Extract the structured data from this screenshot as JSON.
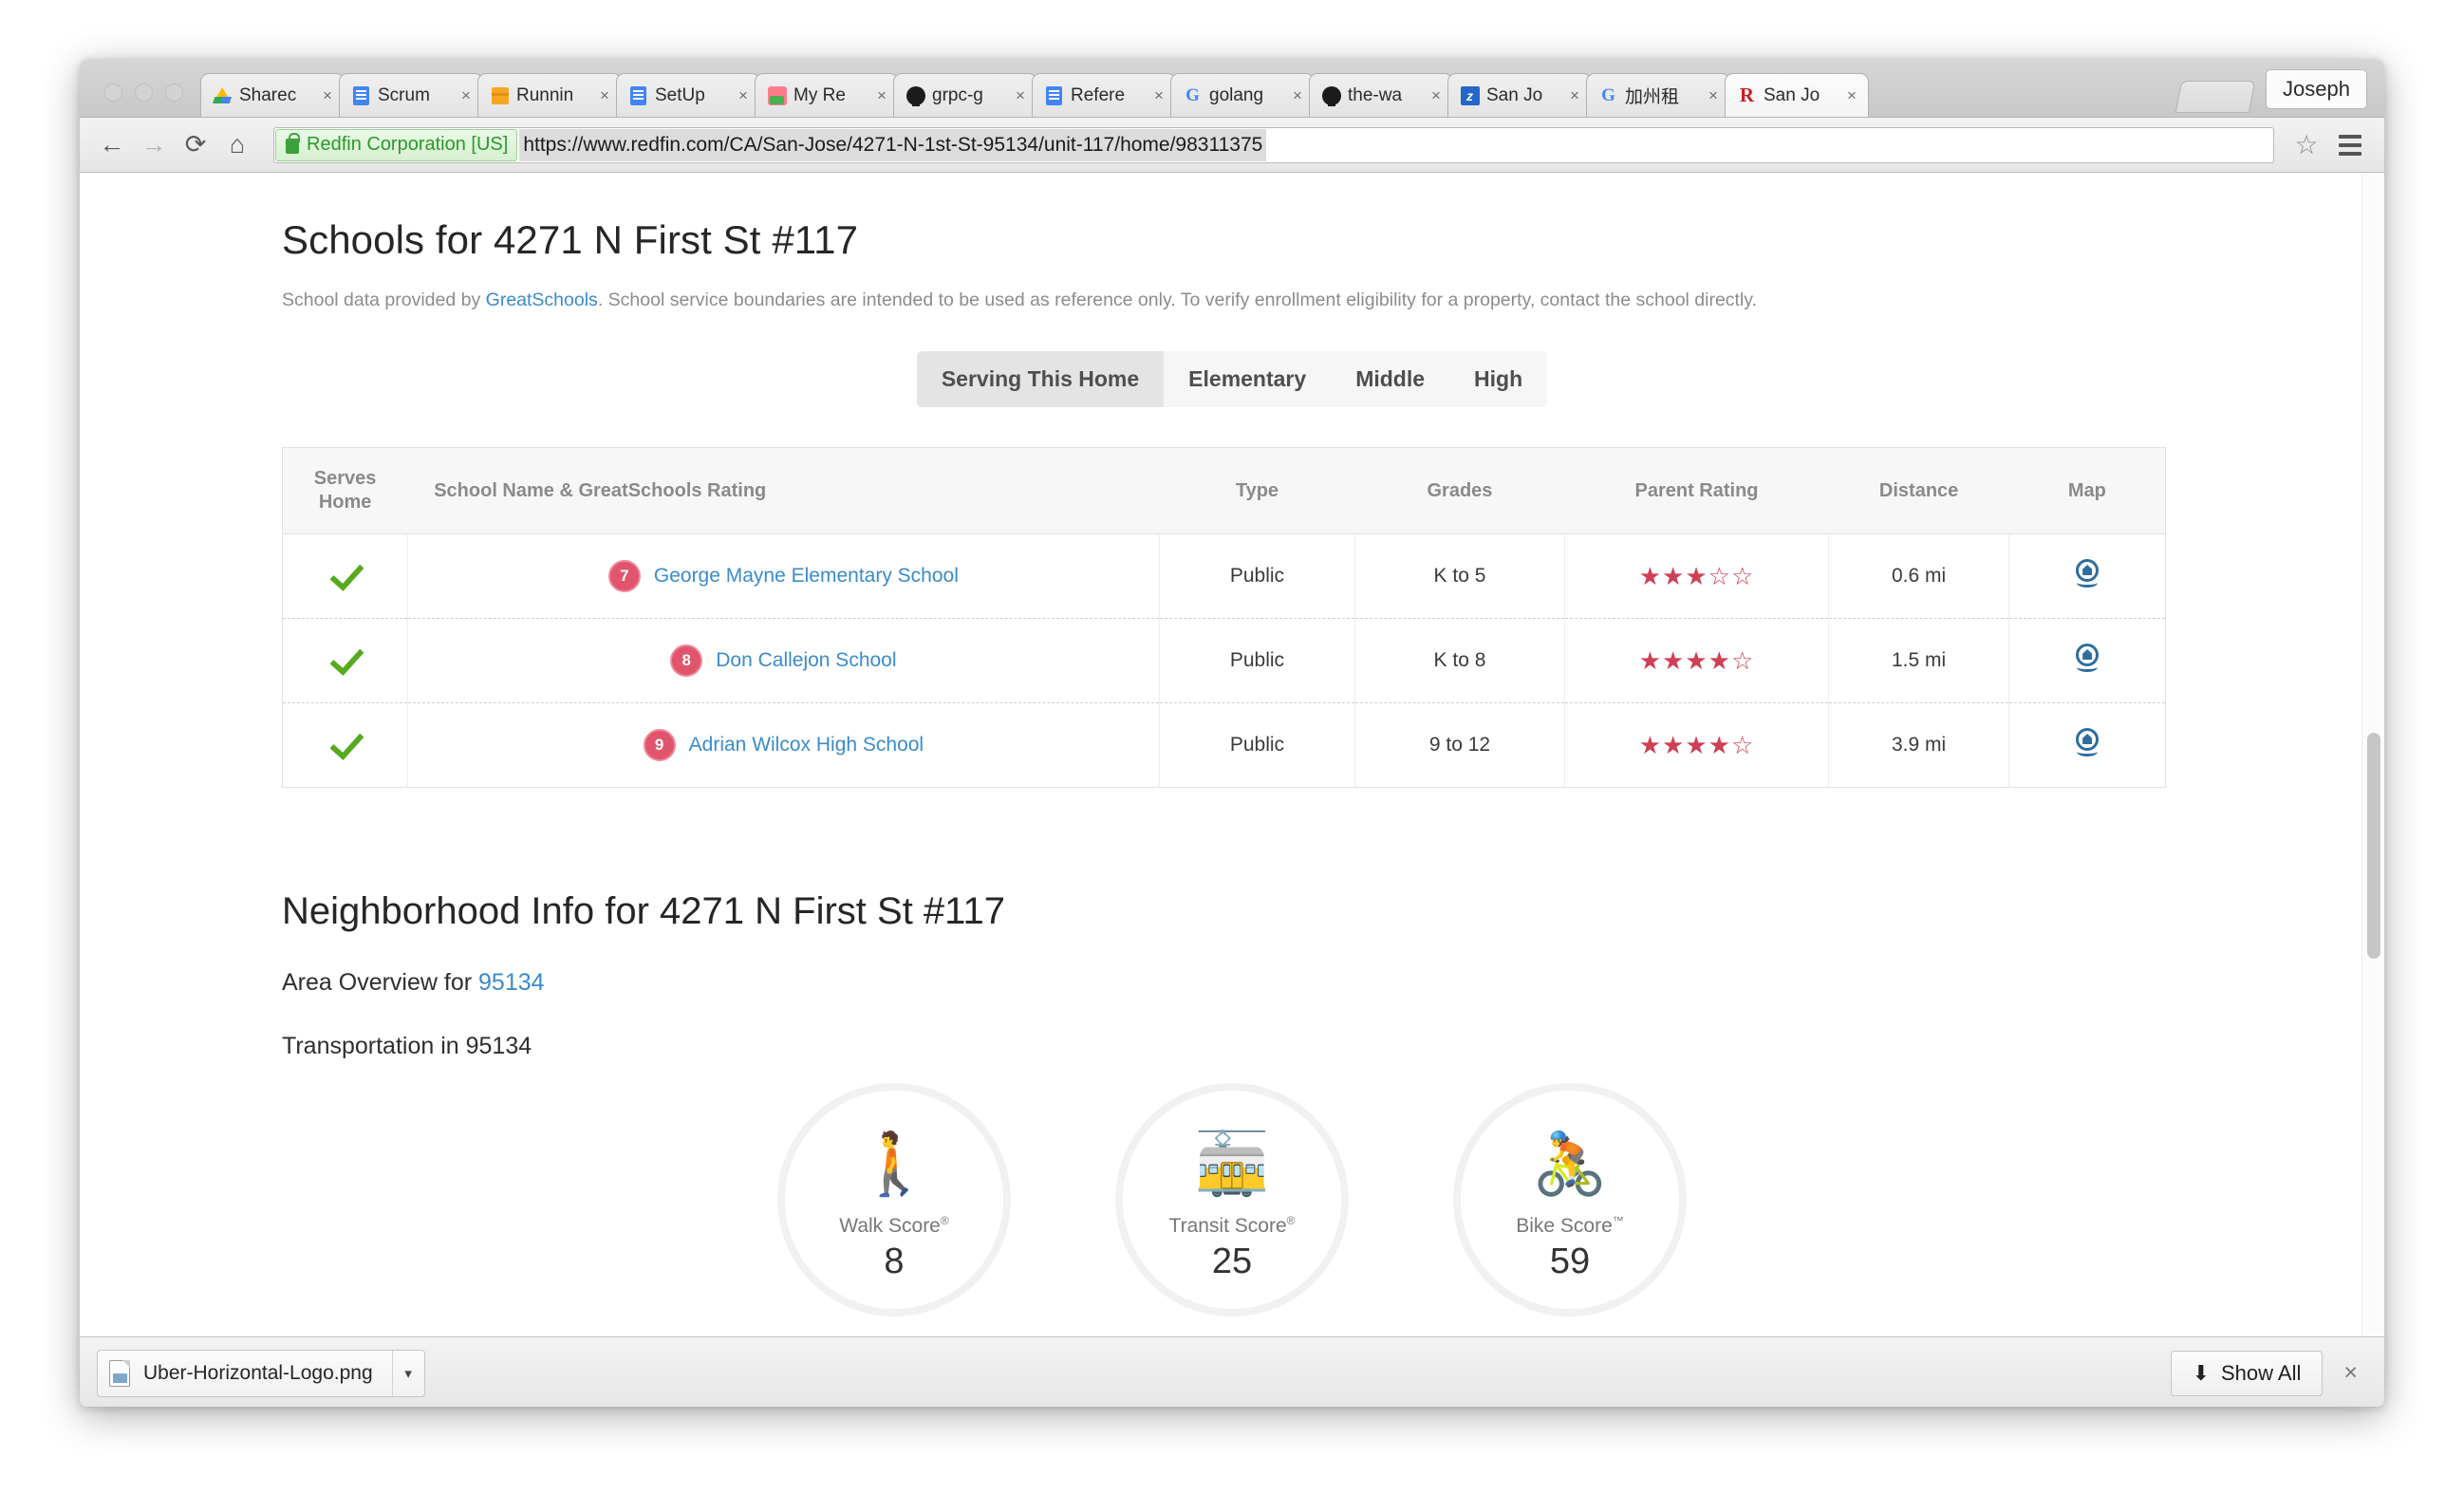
{
  "browser": {
    "profile_label": "Joseph",
    "tabs": [
      {
        "title": "Sharec",
        "icon": "google-drive-icon",
        "icon_kind": "drive",
        "active": false
      },
      {
        "title": "Scrum",
        "icon": "google-docs-icon",
        "icon_kind": "doc",
        "active": false
      },
      {
        "title": "Runnin",
        "icon": "package-box-icon",
        "icon_kind": "box",
        "active": false
      },
      {
        "title": "SetUp",
        "icon": "google-docs-icon",
        "icon_kind": "doc",
        "active": false
      },
      {
        "title": "My Re",
        "icon": "app-icon",
        "icon_kind": "red",
        "active": false
      },
      {
        "title": "grpc-g",
        "icon": "github-icon",
        "icon_kind": "github",
        "active": false
      },
      {
        "title": "Refere",
        "icon": "google-docs-icon",
        "icon_kind": "doc",
        "active": false
      },
      {
        "title": "golang",
        "icon": "google-icon",
        "icon_kind": "google",
        "active": false
      },
      {
        "title": "the-wa",
        "icon": "github-icon",
        "icon_kind": "github",
        "active": false
      },
      {
        "title": "San Jo",
        "icon": "zillow-icon",
        "icon_kind": "blue",
        "active": false
      },
      {
        "title": "加州租",
        "icon": "google-icon",
        "icon_kind": "google",
        "active": false
      },
      {
        "title": "San Jo",
        "icon": "redfin-icon",
        "icon_kind": "redfin",
        "active": true
      }
    ],
    "close_glyph": "×",
    "toolbar": {
      "back": "←",
      "forward": "→",
      "reload": "⟳",
      "home": "⌂",
      "security_label": "Redfin Corporation [US]",
      "url": "https://www.redfin.com/CA/San-Jose/4271-N-1st-St-95134/unit-117/home/98311375",
      "bookmark_star": "☆"
    }
  },
  "page": {
    "schools_title": "Schools for 4271 N First St #117",
    "disclaimer_before": "School data provided by ",
    "disclaimer_link": "GreatSchools",
    "disclaimer_after": ". School service boundaries are intended to be used as reference only. To verify enrollment eligibility for a property, contact the school directly.",
    "filter_tabs": [
      {
        "label": "Serving This Home",
        "active": true
      },
      {
        "label": "Elementary",
        "active": false
      },
      {
        "label": "Middle",
        "active": false
      },
      {
        "label": "High",
        "active": false
      }
    ],
    "table": {
      "headers": {
        "serves_home": "Serves\nHome",
        "serves_home_line1": "Serves",
        "serves_home_line2": "Home",
        "school_name": "School Name & GreatSchools Rating",
        "type": "Type",
        "grades": "Grades",
        "parent_rating": "Parent Rating",
        "distance": "Distance",
        "map": "Map"
      },
      "rows": [
        {
          "serves_home": true,
          "gs_rating": "7",
          "name": "George Mayne Elementary School",
          "type": "Public",
          "grades": "K to 5",
          "parent_rating_filled": 3,
          "parent_rating_total": 5,
          "distance": "0.6 mi"
        },
        {
          "serves_home": true,
          "gs_rating": "8",
          "name": "Don Callejon School",
          "type": "Public",
          "grades": "K to 8",
          "parent_rating_filled": 4,
          "parent_rating_total": 5,
          "distance": "1.5 mi"
        },
        {
          "serves_home": true,
          "gs_rating": "9",
          "name": "Adrian Wilcox High School",
          "type": "Public",
          "grades": "9 to 12",
          "parent_rating_filled": 4,
          "parent_rating_total": 5,
          "distance": "3.9 mi"
        }
      ]
    },
    "neighborhood": {
      "title": "Neighborhood Info for 4271 N First St #117",
      "area_overview_prefix": "Area Overview for ",
      "area_overview_zip": "95134",
      "transportation_line": "Transportation in 95134",
      "scores": [
        {
          "label": "Walk Score",
          "mark": "®",
          "value": "8",
          "glyph": "🚶",
          "icon": "walking-person-icon"
        },
        {
          "label": "Transit Score",
          "mark": "®",
          "value": "25",
          "glyph": "🚋",
          "icon": "transit-bus-icon"
        },
        {
          "label": "Bike Score",
          "mark": "™",
          "value": "59",
          "glyph": "🚴",
          "icon": "bicycle-icon"
        }
      ]
    }
  },
  "downloads": {
    "file_name": "Uber-Horizontal-Logo.png",
    "caret": "▾",
    "show_all_label": "Show All",
    "download_arrow": "⬇",
    "close_glyph": "×"
  },
  "colors": {
    "link_blue": "#3a8bcd",
    "star_red": "#cf4055",
    "gs_badge": "#e0556b",
    "check_green": "#55aa1e",
    "secure_green": "#2a9a2a",
    "pin_blue": "#2f6d9e"
  }
}
